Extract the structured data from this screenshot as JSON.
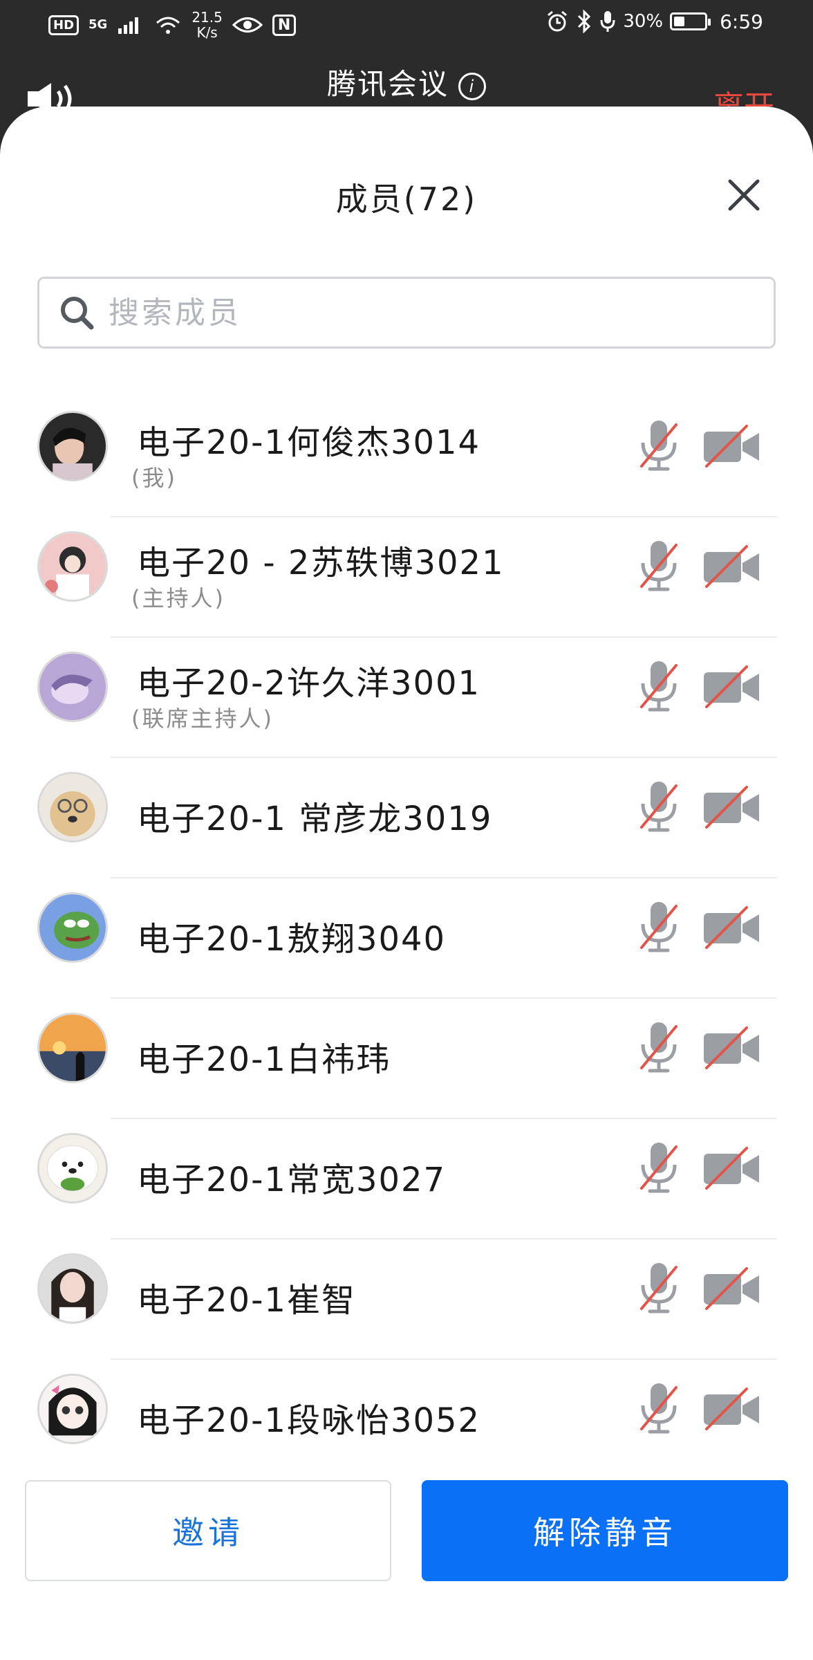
{
  "status_bar": {
    "hd": "HD",
    "network": "5G",
    "speed_value": "21.5",
    "speed_unit": "K/s",
    "nfc": "N",
    "battery_percent": "30%",
    "battery_level": 0.3,
    "time": "6:59"
  },
  "meeting": {
    "title": "腾讯会议",
    "leave_label": "离开"
  },
  "sheet": {
    "title": "成员(72)",
    "search_placeholder": "搜索成员",
    "search_value": ""
  },
  "members": [
    {
      "name": "电子20-1何俊杰3014",
      "role": "(我)",
      "avatar": "photo-man",
      "mic": "muted",
      "camera": "off"
    },
    {
      "name": "电子20 - 2苏轶博3021",
      "role": "(主持人)",
      "avatar": "illustration-girl",
      "mic": "muted",
      "camera": "off"
    },
    {
      "name": "电子20-2许久洋3001",
      "role": "(联席主持人)",
      "avatar": "purple-illustration",
      "mic": "muted",
      "camera": "off"
    },
    {
      "name": "电子20-1 常彦龙3019",
      "role": "",
      "avatar": "dog-glasses",
      "mic": "muted",
      "camera": "off"
    },
    {
      "name": "电子20-1敖翔3040",
      "role": "",
      "avatar": "frog-meme",
      "mic": "muted",
      "camera": "off"
    },
    {
      "name": "电子20-1白祎玮",
      "role": "",
      "avatar": "sunset-silhouette",
      "mic": "muted",
      "camera": "off"
    },
    {
      "name": "电子20-1常宽3027",
      "role": "",
      "avatar": "white-dog",
      "mic": "muted",
      "camera": "off"
    },
    {
      "name": "电子20-1崔智",
      "role": "",
      "avatar": "girl-photo",
      "mic": "muted",
      "camera": "off"
    },
    {
      "name": "电子20-1段咏怡3052",
      "role": "",
      "avatar": "anime-girl",
      "mic": "muted",
      "camera": "off"
    }
  ],
  "actions": {
    "invite_label": "邀请",
    "unmute_label": "解除静音"
  },
  "colors": {
    "accent": "#0a70f5",
    "leave": "#e9483d",
    "muted_slash": "#e2544a"
  }
}
